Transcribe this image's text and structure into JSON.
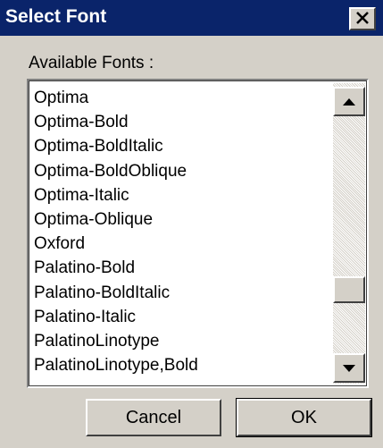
{
  "window": {
    "title": "Select Font",
    "close_glyph": "✕"
  },
  "dialog": {
    "list_label": "Available Fonts :",
    "fonts": [
      "Optima",
      "Optima-Bold",
      "Optima-BoldItalic",
      "Optima-BoldOblique",
      "Optima-Italic",
      "Optima-Oblique",
      "Oxford",
      "Palatino-Bold",
      "Palatino-BoldItalic",
      "Palatino-Italic",
      "PalatinoLinotype",
      "PalatinoLinotype,Bold"
    ],
    "scroll_position_fraction": 0.75
  },
  "buttons": {
    "cancel": "Cancel",
    "ok": "OK"
  },
  "icons": {
    "close": "close-icon",
    "scroll_up": "triangle-up-icon",
    "scroll_down": "triangle-down-icon"
  },
  "colors": {
    "titlebar": "#0a246a",
    "face": "#d4d0c8",
    "list_bg": "#ffffff"
  }
}
